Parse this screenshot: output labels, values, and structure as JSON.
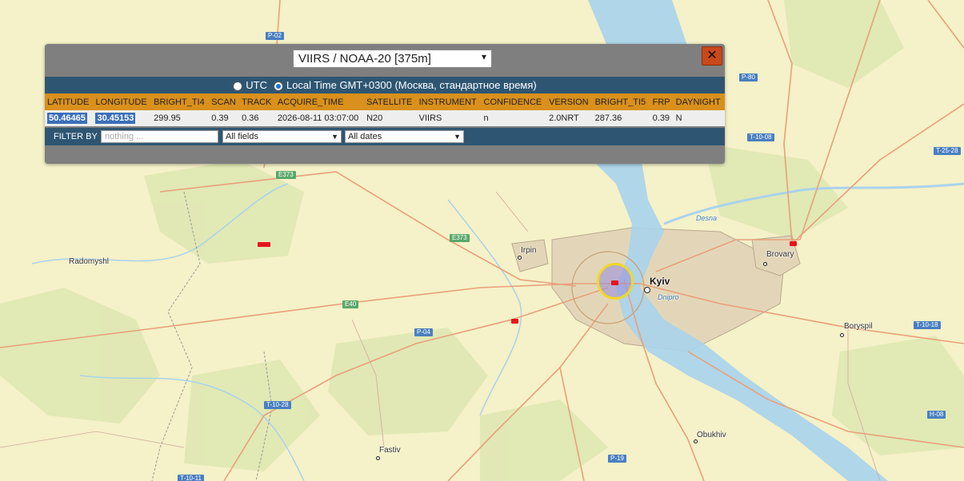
{
  "panel": {
    "satellite_select": "VIIRS / NOAA-20 [375m]",
    "close_icon": "close-icon",
    "close_glyph": "✕",
    "timezone": {
      "utc_label": "UTC",
      "local_label": "Local Time GMT+0300 (Москва, стандартное время)",
      "selected": "local"
    },
    "table": {
      "columns": [
        "LATITUDE",
        "LONGITUDE",
        "BRIGHT_TI4",
        "SCAN",
        "TRACK",
        "ACQUIRE_TIME",
        "SATELLITE",
        "INSTRUMENT",
        "CONFIDENCE",
        "VERSION",
        "BRIGHT_TI5",
        "FRP",
        "DAYNIGHT"
      ],
      "row": [
        "50.46465",
        "30.45153",
        "299.95",
        "0.39",
        "0.36",
        "2026-08-11 03:07:00",
        "N20",
        "VIIRS",
        "n",
        "2.0NRT",
        "287.36",
        "0.39",
        "N"
      ]
    },
    "filter": {
      "label": "FILTER BY",
      "placeholder": "nothing ...",
      "field_select": "All fields",
      "date_select": "All dates"
    }
  },
  "map": {
    "places": {
      "kyiv": "Kyiv",
      "irpin": "Irpin",
      "brovary": "Brovary",
      "boryspil": "Boryspil",
      "radomyshl": "Radomyshl",
      "fastiv": "Fastiv",
      "obukhiv": "Obukhiv",
      "desna": "Desna",
      "dnipro": "Dnipro"
    },
    "roads": {
      "p02": "P-02",
      "p80": "P-80",
      "t1008": "T-10-08",
      "t2528": "T-25-28",
      "e373a": "E373",
      "e373b": "E373",
      "e40": "E40",
      "p04": "P-04",
      "t1018": "T-10-18",
      "t1028": "T-10-28",
      "h08": "H-08",
      "p19": "P-19",
      "t1011": "T-10-11"
    },
    "colors": {
      "fire": "#e8141c",
      "selection_ring": "#f0d824",
      "header_orange": "#d9901c",
      "bar_blue": "#2e5672"
    }
  }
}
